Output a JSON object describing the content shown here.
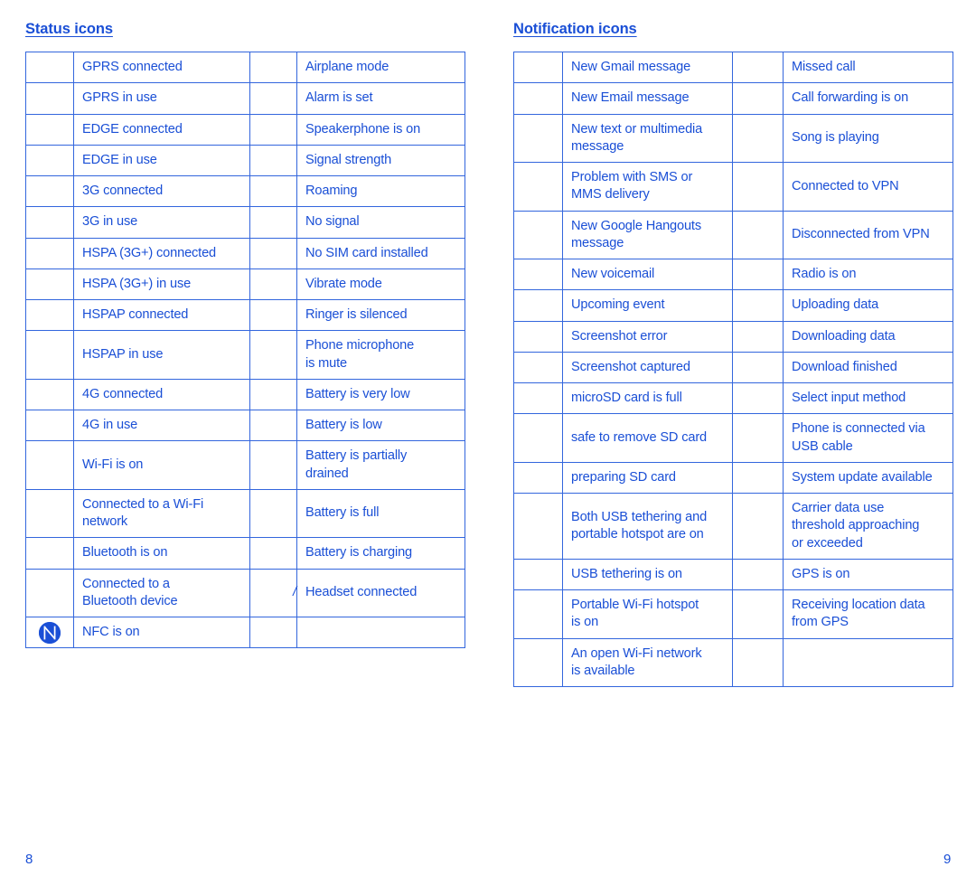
{
  "colors": {
    "text": "#1A4FD6",
    "border": "#3366DD",
    "background": "#FFFFFF"
  },
  "sections": {
    "status": {
      "heading": "Status icons",
      "rows": [
        {
          "left_icon": "",
          "left_label": "GPRS connected",
          "right_icon": "",
          "right_label": "Airplane mode"
        },
        {
          "left_icon": "",
          "left_label": "GPRS in use",
          "right_icon": "",
          "right_label": "Alarm is set"
        },
        {
          "left_icon": "",
          "left_label": "EDGE connected",
          "right_icon": "",
          "right_label": "Speakerphone is on"
        },
        {
          "left_icon": "",
          "left_label": "EDGE in use",
          "right_icon": "",
          "right_label": "Signal strength"
        },
        {
          "left_icon": "",
          "left_label": "3G connected",
          "right_icon": "",
          "right_label": "Roaming"
        },
        {
          "left_icon": "",
          "left_label": "3G in use",
          "right_icon": "",
          "right_label": "No signal"
        },
        {
          "left_icon": "",
          "left_label": "HSPA (3G+) connected",
          "right_icon": "",
          "right_label": "No SIM card installed"
        },
        {
          "left_icon": "",
          "left_label": "HSPA (3G+) in use",
          "right_icon": "",
          "right_label": "Vibrate mode"
        },
        {
          "left_icon": "",
          "left_label": "HSPAP connected",
          "right_icon": "",
          "right_label": "Ringer is silenced"
        },
        {
          "left_icon": "",
          "left_label": "HSPAP in use",
          "right_icon": "",
          "right_label": "Phone microphone\nis mute"
        },
        {
          "left_icon": "",
          "left_label": "4G connected",
          "right_icon": "",
          "right_label": "Battery is very low"
        },
        {
          "left_icon": "",
          "left_label": "4G in use",
          "right_icon": "",
          "right_label": "Battery is low"
        },
        {
          "left_icon": "",
          "left_label": "Wi-Fi is on",
          "right_icon": "",
          "right_label": "Battery is partially\ndrained"
        },
        {
          "left_icon": "",
          "left_label": "Connected to a Wi-Fi\nnetwork",
          "right_icon": "",
          "right_label": "Battery is full"
        },
        {
          "left_icon": "",
          "left_label": "Bluetooth is on",
          "right_icon": "",
          "right_label": "Battery is charging"
        },
        {
          "left_icon": "",
          "left_label": "Connected to a\nBluetooth device",
          "right_icon": "/",
          "right_label": "Headset connected"
        },
        {
          "left_icon": "nfc-icon",
          "left_label": "NFC is on",
          "right_icon": "",
          "right_label": ""
        }
      ]
    },
    "notification": {
      "heading": "Notification icons",
      "rows": [
        {
          "left_icon": "",
          "left_label": "New Gmail message",
          "right_icon": "",
          "right_label": "Missed call"
        },
        {
          "left_icon": "",
          "left_label": "New Email message",
          "right_icon": "",
          "right_label": "Call forwarding is on"
        },
        {
          "left_icon": "",
          "left_label": "New text or multimedia\nmessage",
          "right_icon": "",
          "right_label": "Song is playing"
        },
        {
          "left_icon": "",
          "left_label": "Problem with SMS or\nMMS delivery",
          "right_icon": "",
          "right_label": "Connected to VPN"
        },
        {
          "left_icon": "",
          "left_label": "New Google Hangouts\nmessage",
          "right_icon": "",
          "right_label": "Disconnected from VPN"
        },
        {
          "left_icon": "",
          "left_label": "New voicemail",
          "right_icon": "",
          "right_label": "Radio is on"
        },
        {
          "left_icon": "",
          "left_label": "Upcoming event",
          "right_icon": "",
          "right_label": "Uploading data"
        },
        {
          "left_icon": "",
          "left_label": "Screenshot error",
          "right_icon": "",
          "right_label": "Downloading data"
        },
        {
          "left_icon": "",
          "left_label": "Screenshot captured",
          "right_icon": "",
          "right_label": "Download finished",
          "indent": true
        },
        {
          "left_icon": "",
          "left_label": "microSD card is full",
          "right_icon": "",
          "right_label": "Select input method"
        },
        {
          "left_icon": "",
          "left_label": "safe to remove SD card",
          "right_icon": "",
          "right_label": "Phone is connected via\nUSB cable"
        },
        {
          "left_icon": "",
          "left_label": "preparing SD card",
          "right_icon": "",
          "right_label": "System update available"
        },
        {
          "left_icon": "",
          "left_label": "Both USB tethering and\nportable hotspot are on",
          "right_icon": "",
          "right_label": "Carrier data use\nthreshold approaching\nor exceeded"
        },
        {
          "left_icon": "",
          "left_label": "USB tethering is on",
          "right_icon": "",
          "right_label": "GPS is on"
        },
        {
          "left_icon": "",
          "left_label": "Portable Wi-Fi hotspot\nis on",
          "right_icon": "",
          "right_label": "Receiving location data\nfrom GPS"
        },
        {
          "left_icon": "",
          "left_label": "An open Wi-Fi network\nis available",
          "right_icon": "",
          "right_label": ""
        }
      ]
    }
  },
  "footer": {
    "page_left": "8",
    "page_right": "9"
  }
}
